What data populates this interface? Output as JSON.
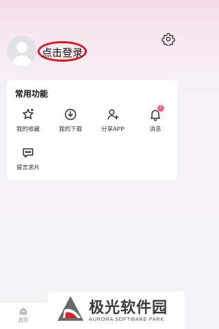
{
  "header": {
    "login_text": "点击登录",
    "settings_icon": "gear-icon",
    "avatar_icon": "user-avatar-placeholder"
  },
  "functions_card": {
    "title": "常用功能",
    "items": [
      {
        "label": "我的收藏",
        "icon": "star-sparkle-icon"
      },
      {
        "label": "我的下载",
        "icon": "download-circle-icon"
      },
      {
        "label": "分享APP",
        "icon": "add-user-icon"
      },
      {
        "label": "消息",
        "icon": "bell-icon",
        "badge": "1"
      },
      {
        "label": "留言求片",
        "icon": "message-bubble-icon"
      }
    ]
  },
  "tabbar": {
    "home_label": "首页",
    "home_icon": "home-icon"
  },
  "watermark": {
    "title": "极光软件园",
    "subtitle": "AURORA SOFTWARE PARK"
  },
  "colors": {
    "highlight_ellipse": "#e5141f",
    "badge": "#ff5a83",
    "card_background": "#ffffff"
  }
}
